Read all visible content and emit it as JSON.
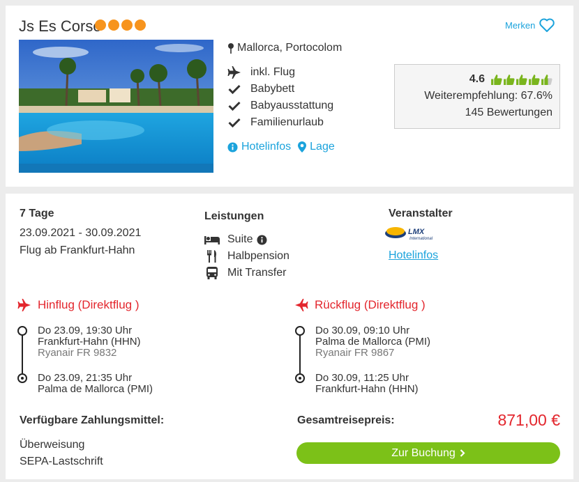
{
  "hotel": {
    "name": "Js Es Corso",
    "stars": 4,
    "location": "Mallorca, Portocolom",
    "features": [
      "inkl. Flug",
      "Babybett",
      "Babyausstattung",
      "Familienurlaub"
    ],
    "feature_icons": [
      "plane-icon",
      "check-icon",
      "check-icon",
      "check-icon"
    ],
    "links": {
      "hotelinfos": "Hotelinfos",
      "lage": "Lage"
    },
    "merken": "Merken"
  },
  "rating": {
    "score": "4.6",
    "thumbs_filled": 4.6,
    "thumbs_total": 5,
    "recommendation": "Weiterempfehlung: 67.6%",
    "reviews": "145 Bewertungen"
  },
  "trip": {
    "duration": "7 Tage",
    "dates": "23.09.2021 - 30.09.2021",
    "departure": "Flug ab Frankfurt-Hahn"
  },
  "leistungen": {
    "title": "Leistungen",
    "items": [
      "Suite",
      "Halbpension",
      "Mit Transfer"
    ]
  },
  "veranstalter": {
    "title": "Veranstalter",
    "logo_text": "LMX",
    "logo_sub": "International",
    "link": "Hotelinfos"
  },
  "hinflug": {
    "title": "Hinflug (Direktflug )",
    "dep_time": "Do 23.09, 19:30 Uhr",
    "dep_airport": "Frankfurt-Hahn (HHN)",
    "flight": "Ryanair FR 9832",
    "arr_time": "Do 23.09, 21:35 Uhr",
    "arr_airport": "Palma de Mallorca (PMI)"
  },
  "rueckflug": {
    "title": "Rückflug (Direktflug )",
    "dep_time": "Do 30.09, 09:10 Uhr",
    "dep_airport": "Palma de Mallorca (PMI)",
    "flight": "Ryanair FR 9867",
    "arr_time": "Do 30.09, 11:25 Uhr",
    "arr_airport": "Frankfurt-Hahn (HHN)"
  },
  "payment": {
    "title": "Verfügbare Zahlungsmittel:",
    "methods": [
      "Überweisung",
      "SEPA-Lastschrift"
    ]
  },
  "total": {
    "label": "Gesamtreisepreis:",
    "price": "871,00 €",
    "button": "Zur Buchung"
  },
  "colors": {
    "accent_blue": "#1ba3dc",
    "star_orange": "#f7941d",
    "price_red": "#e3262d",
    "button_green": "#7cc118",
    "thumb_green": "#7ab51d"
  }
}
